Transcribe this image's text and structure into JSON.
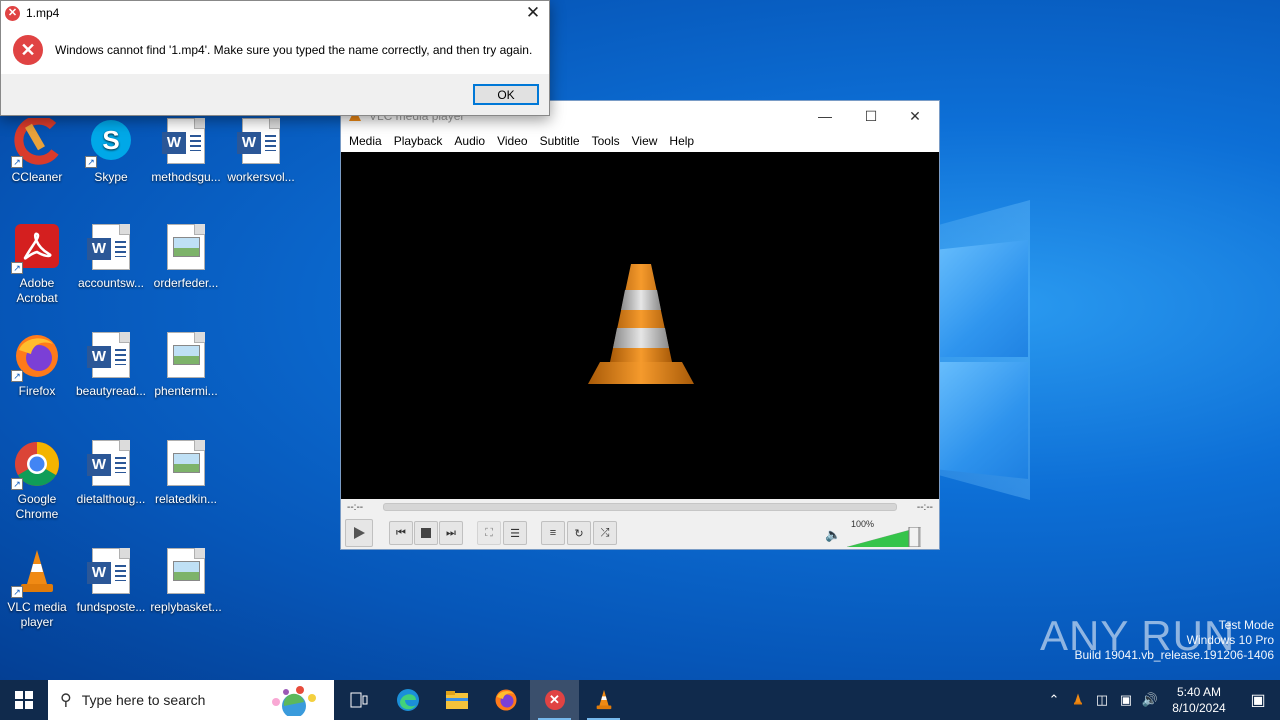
{
  "dialog": {
    "title": "1.mp4",
    "message": "Windows cannot find '1.mp4'. Make sure you typed the name correctly, and then try again.",
    "ok_label": "OK"
  },
  "vlc": {
    "title": "VLC media player",
    "menu": [
      "Media",
      "Playback",
      "Audio",
      "Video",
      "Subtitle",
      "Tools",
      "View",
      "Help"
    ],
    "time_elapsed": "--:--",
    "time_total": "--:--",
    "volume_label": "100%",
    "volume": 1.0
  },
  "desktop_icons": [
    {
      "label": "CCleaner",
      "icon": "ccleaner-icon"
    },
    {
      "label": "Skype",
      "icon": "skype-icon"
    },
    {
      "label": "methodsgu...",
      "icon": "word-doc-icon"
    },
    {
      "label": "workersvol...",
      "icon": "word-doc-icon"
    },
    {
      "label": "Adobe Acrobat",
      "icon": "acrobat-icon"
    },
    {
      "label": "accountsw...",
      "icon": "word-doc-icon"
    },
    {
      "label": "orderfeder...",
      "icon": "image-file-icon"
    },
    {
      "label": "Firefox",
      "icon": "firefox-icon"
    },
    {
      "label": "beautyread...",
      "icon": "word-doc-icon"
    },
    {
      "label": "phentermi...",
      "icon": "image-file-icon"
    },
    {
      "label": "Google Chrome",
      "icon": "chrome-icon"
    },
    {
      "label": "dietalthoug...",
      "icon": "word-doc-icon"
    },
    {
      "label": "relatedkin...",
      "icon": "image-file-icon"
    },
    {
      "label": "VLC media player",
      "icon": "vlc-icon"
    },
    {
      "label": "fundsposte...",
      "icon": "word-doc-icon"
    },
    {
      "label": "replybasket...",
      "icon": "image-file-icon"
    }
  ],
  "watermark": {
    "brand": "ANY RUN",
    "line1": "Test Mode",
    "line2": "Windows 10 Pro",
    "line3": "Build 19041.vb_release.191206-1406"
  },
  "taskbar": {
    "search_placeholder": "Type here to search",
    "time": "5:40 AM",
    "date": "8/10/2024"
  },
  "colors": {
    "taskbar": "#102a4c",
    "error_red": "#e04343",
    "vlc_orange": "#f08a14",
    "accent": "#0078d7"
  }
}
